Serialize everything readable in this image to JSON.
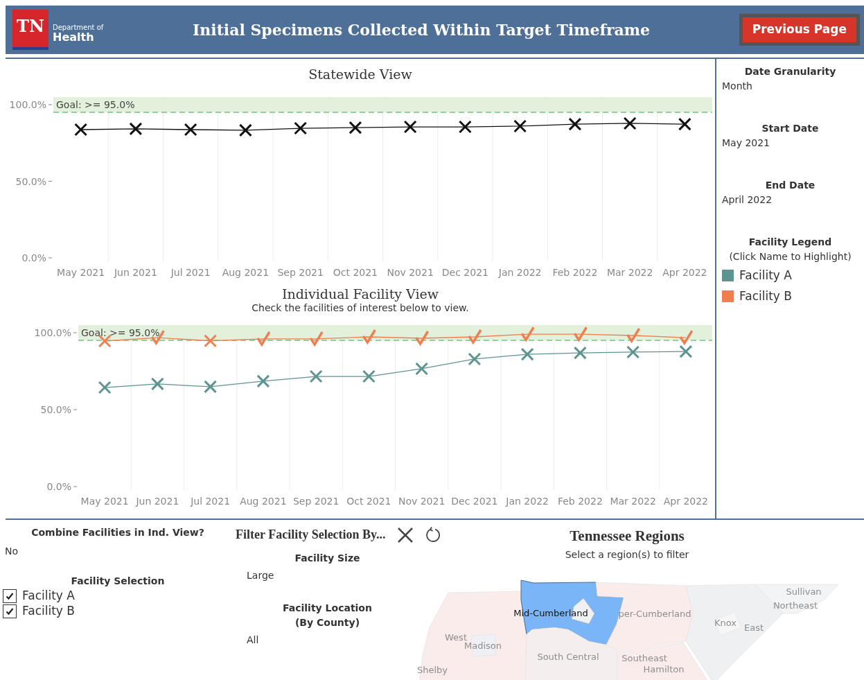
{
  "header": {
    "logo_mark": "TN",
    "logo_small": "Department of",
    "logo_big": "Health",
    "title": "Initial Specimens Collected Within Target Timeframe",
    "button": "Previous Page"
  },
  "statewide": {
    "chart_data": {
      "type": "line",
      "title": "Statewide View",
      "categories": [
        "May 2021",
        "Jun 2021",
        "Jul 2021",
        "Aug 2021",
        "Sep 2021",
        "Oct 2021",
        "Nov 2021",
        "Dec 2021",
        "Jan 2022",
        "Feb 2022",
        "Mar 2022",
        "Apr 2022"
      ],
      "series": [
        {
          "color": "#111111",
          "marker": "cross",
          "values": [
            83.7,
            84.2,
            83.7,
            83.3,
            84.6,
            85.0,
            85.5,
            85.5,
            86.0,
            87.3,
            87.8,
            87.3
          ]
        }
      ],
      "ylim": [
        0,
        105
      ],
      "yticks": [
        {
          "value": 0,
          "label": "0.0%"
        },
        {
          "value": 50,
          "label": "50.0%"
        },
        {
          "value": 100,
          "label": "100.0%"
        }
      ],
      "ref_lines": [
        {
          "axis": "y",
          "value": 95,
          "label": "Goal: >= 95.0%"
        }
      ],
      "bands": [
        {
          "axis": "y",
          "from": 95,
          "to": 105
        }
      ]
    }
  },
  "individual": {
    "subtitle": "Check the facilities of interest below to view.",
    "chart_data": {
      "type": "line",
      "title": "Individual Facility View",
      "categories": [
        "May 2021",
        "Jun 2021",
        "Jul 2021",
        "Aug 2021",
        "Sep 2021",
        "Oct 2021",
        "Nov 2021",
        "Dec 2021",
        "Jan 2022",
        "Feb 2022",
        "Mar 2022",
        "Apr 2022"
      ],
      "series": [
        {
          "color": "#5b9490",
          "marker": "cross",
          "values": [
            64.4,
            66.7,
            64.9,
            68.5,
            71.6,
            71.6,
            76.6,
            82.9,
            86.0,
            86.9,
            87.4,
            87.8
          ]
        },
        {
          "color": "#f07f50",
          "marker": "cross",
          "values": [
            94.6,
            96.8,
            94.7,
            96.0,
            96.0,
            97.3,
            96.4,
            97.3,
            99.0,
            99.0,
            98.2,
            96.8
          ]
        }
      ],
      "ylim": [
        0,
        105
      ],
      "yticks": [
        {
          "value": 0,
          "label": "0.0%"
        },
        {
          "value": 50,
          "label": "50.0%"
        },
        {
          "value": 100,
          "label": "100.0%"
        }
      ],
      "ref_lines": [
        {
          "axis": "y",
          "value": 95,
          "label": "Goal: >= 95.0%"
        }
      ],
      "bands": [
        {
          "axis": "y",
          "from": 95,
          "to": 105
        }
      ]
    }
  },
  "sidebar": {
    "filters": [
      {
        "label": "Date Granularity",
        "value": "Month"
      },
      {
        "label": "Start Date",
        "value": "May 2021"
      },
      {
        "label": "End Date",
        "value": "April 2022"
      }
    ],
    "legend_title": "Facility Legend",
    "legend_hint": "(Click Name to Highlight)",
    "legend": [
      {
        "name": "Facility A",
        "color": "#5b9490"
      },
      {
        "name": "Facility B",
        "color": "#f07f50"
      }
    ]
  },
  "combine": {
    "label": "Combine Facilities in Ind. View?",
    "value": "No"
  },
  "facility_selection": {
    "label": "Facility Selection",
    "items": [
      {
        "name": "Facility A",
        "checked": true
      },
      {
        "name": "Facility B",
        "checked": true
      }
    ]
  },
  "filter": {
    "title": "Filter Facility Selection By...",
    "fields": [
      {
        "label": "Facility Size",
        "value": "Large"
      },
      {
        "label": "Facility Location\n(By County)",
        "value": "All"
      }
    ]
  },
  "regions": {
    "title": "Tennessee Regions",
    "hint": "Select a region(s) to filter",
    "items": [
      {
        "label": "West",
        "selected": false
      },
      {
        "label": "Madison",
        "selected": false
      },
      {
        "label": "Shelby",
        "selected": false
      },
      {
        "label": "Mid-Cumberland",
        "selected": true
      },
      {
        "label": "per-Cumberland",
        "selected": false
      },
      {
        "label": "South Central",
        "selected": false
      },
      {
        "label": "Southeast",
        "selected": false
      },
      {
        "label": "Hamilton",
        "selected": false
      },
      {
        "label": "East",
        "selected": false
      },
      {
        "label": "Knox",
        "selected": false
      },
      {
        "label": "Northeast",
        "selected": false
      },
      {
        "label": "Sullivan",
        "selected": false
      }
    ]
  }
}
